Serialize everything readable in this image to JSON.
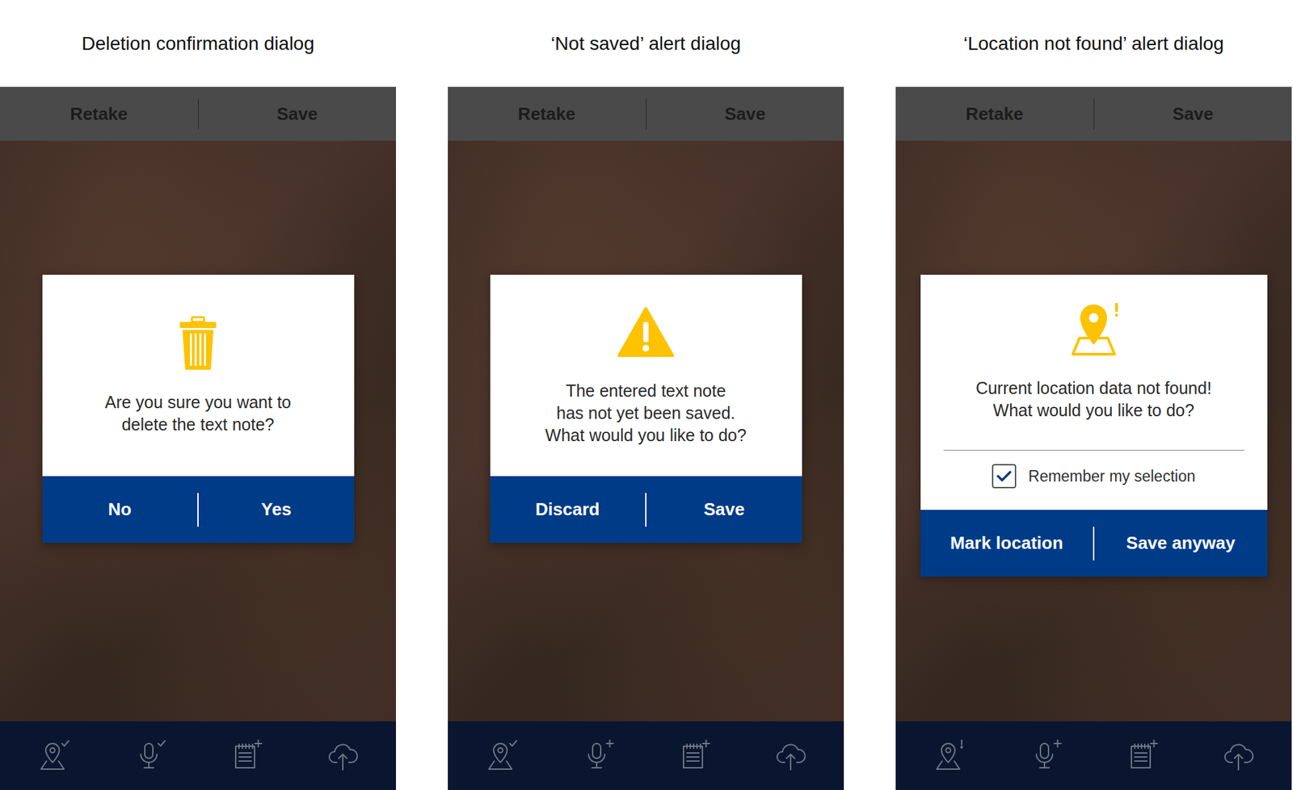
{
  "screens": [
    {
      "caption": "Deletion confirmation dialog",
      "toolbar": [
        "Retake",
        "Save"
      ],
      "dialog": {
        "kind": "delete",
        "message": [
          "Are you sure you want to",
          "delete the text note?"
        ],
        "buttons": [
          "No",
          "Yes"
        ]
      },
      "nav": [
        {
          "kind": "location",
          "badge": "check"
        },
        {
          "kind": "audio",
          "badge": "check"
        },
        {
          "kind": "note",
          "badge": "plus"
        },
        {
          "kind": "upload",
          "badge": "none"
        }
      ]
    },
    {
      "caption": "‘Not saved’ alert dialog",
      "toolbar": [
        "Retake",
        "Save"
      ],
      "dialog": {
        "kind": "warning",
        "message": [
          "The entered text note",
          "has not yet been saved.",
          "What would you like to do?"
        ],
        "buttons": [
          "Discard",
          "Save"
        ]
      },
      "nav": [
        {
          "kind": "location",
          "badge": "check"
        },
        {
          "kind": "audio",
          "badge": "plus"
        },
        {
          "kind": "note",
          "badge": "plus"
        },
        {
          "kind": "upload",
          "badge": "none"
        }
      ]
    },
    {
      "caption": "‘Location not found’ alert dialog",
      "toolbar": [
        "Retake",
        "Save"
      ],
      "dialog": {
        "kind": "location",
        "message": [
          "Current location data not found!",
          "What would you like to do?"
        ],
        "option": {
          "label": "Remember my selection",
          "checked": true
        },
        "buttons": [
          "Mark location",
          "Save anyway"
        ]
      },
      "nav": [
        {
          "kind": "location",
          "badge": "alert"
        },
        {
          "kind": "audio",
          "badge": "plus"
        },
        {
          "kind": "note",
          "badge": "plus"
        },
        {
          "kind": "upload",
          "badge": "none"
        }
      ]
    }
  ]
}
